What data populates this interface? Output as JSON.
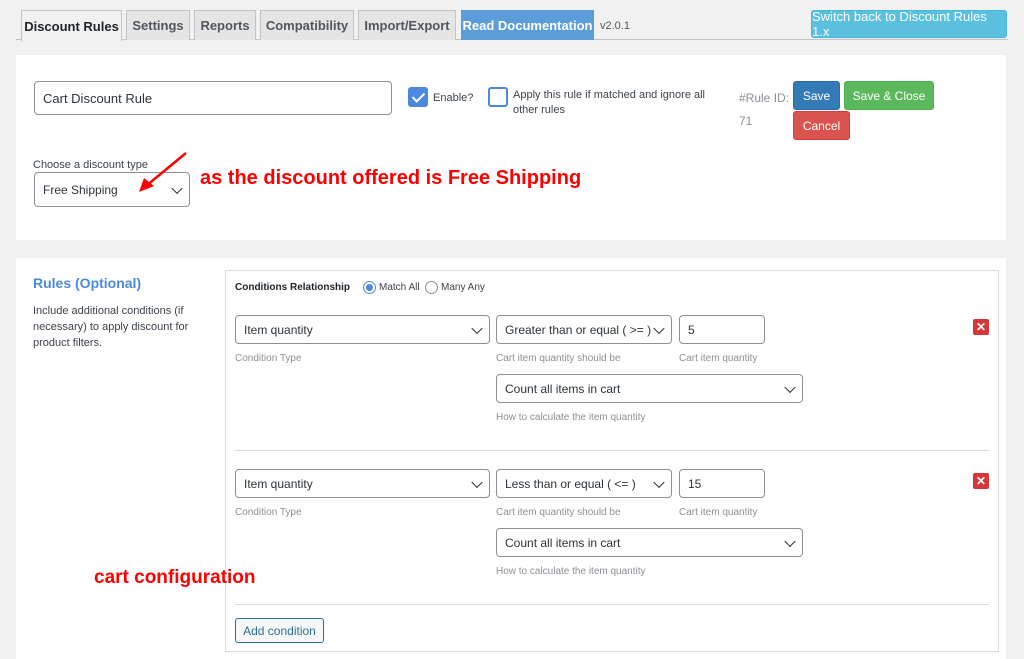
{
  "tabs": [
    {
      "label": "Discount Rules"
    },
    {
      "label": "Settings"
    },
    {
      "label": "Reports"
    },
    {
      "label": "Compatibility"
    },
    {
      "label": "Import/Export"
    },
    {
      "label": "Read Documentation"
    }
  ],
  "version": "v2.0.1",
  "switch_button": "Switch back to Discount Rules 1.x",
  "rule": {
    "name_value": "Cart Discount Rule",
    "enable_label": "Enable?",
    "enable_checked": true,
    "apply_label": "Apply this rule if matched and ignore all other rules",
    "apply_checked": false,
    "rule_id_label": "#Rule ID:",
    "rule_id_value": "71",
    "save_label": "Save",
    "save_close_label": "Save & Close",
    "cancel_label": "Cancel",
    "discount_type_label": "Choose a discount type",
    "discount_type_value": "Free Shipping"
  },
  "annotations": {
    "discount_note": "as the discount offered is Free Shipping",
    "cart_note": "cart configuration"
  },
  "rules": {
    "title": "Rules (Optional)",
    "description": "Include additional conditions (if necessary) to apply discount for product filters.",
    "relationship_label": "Conditions Relationship",
    "match_all_label": "Match All",
    "many_any_label": "Many Any",
    "selected_relationship": "Match All",
    "conditions": [
      {
        "type": "Item quantity",
        "type_hint": "Condition Type",
        "operator": "Greater than or equal ( >= )",
        "operator_hint": "Cart item quantity should be",
        "value": "5",
        "value_hint": "Cart item quantity",
        "calc": "Count all items in cart",
        "calc_hint": "How to calculate the item quantity"
      },
      {
        "type": "Item quantity",
        "type_hint": "Condition Type",
        "operator": "Less than or equal ( <= )",
        "operator_hint": "Cart item quantity should be",
        "value": "15",
        "value_hint": "Cart item quantity",
        "calc": "Count all items in cart",
        "calc_hint": "How to calculate the item quantity"
      }
    ],
    "add_condition_label": "Add condition"
  },
  "colors": {
    "accent": "#4a89dc",
    "annotation": "#ff0000",
    "save": "#337ab7",
    "save_close": "#5cb85c",
    "cancel": "#d9534f",
    "switch": "#5bc0de"
  }
}
